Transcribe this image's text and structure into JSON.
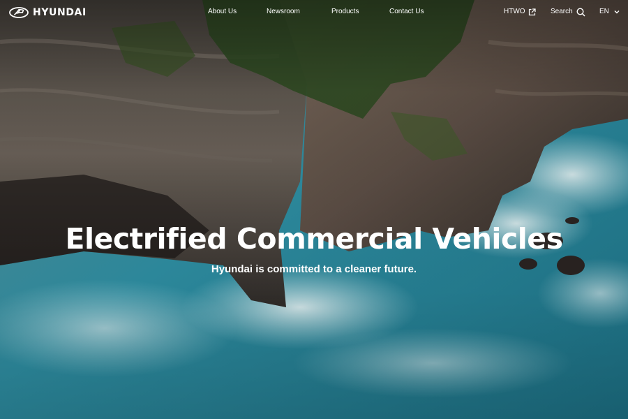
{
  "header": {
    "logo_text": "HYUNDAI",
    "nav": [
      {
        "label": "About Us"
      },
      {
        "label": "Newsroom"
      },
      {
        "label": "Products"
      },
      {
        "label": "Contact Us"
      }
    ],
    "htwo_label": "HTWO",
    "htwo_icon": "external-link-icon",
    "search_label": "Search",
    "search_icon": "search-icon",
    "language_label": "EN",
    "language_icon": "chevron-down-icon"
  },
  "hero": {
    "title": "Electrified Commercial Vehicles",
    "subtitle": "Hyundai is committed to a cleaner future.",
    "background": "coastal-cliff-ocean-waves-photo"
  },
  "colors": {
    "text": "#ffffff",
    "ocean": "#2f8fa3",
    "cliff": "#5a5048",
    "foliage": "#2f4a22"
  }
}
